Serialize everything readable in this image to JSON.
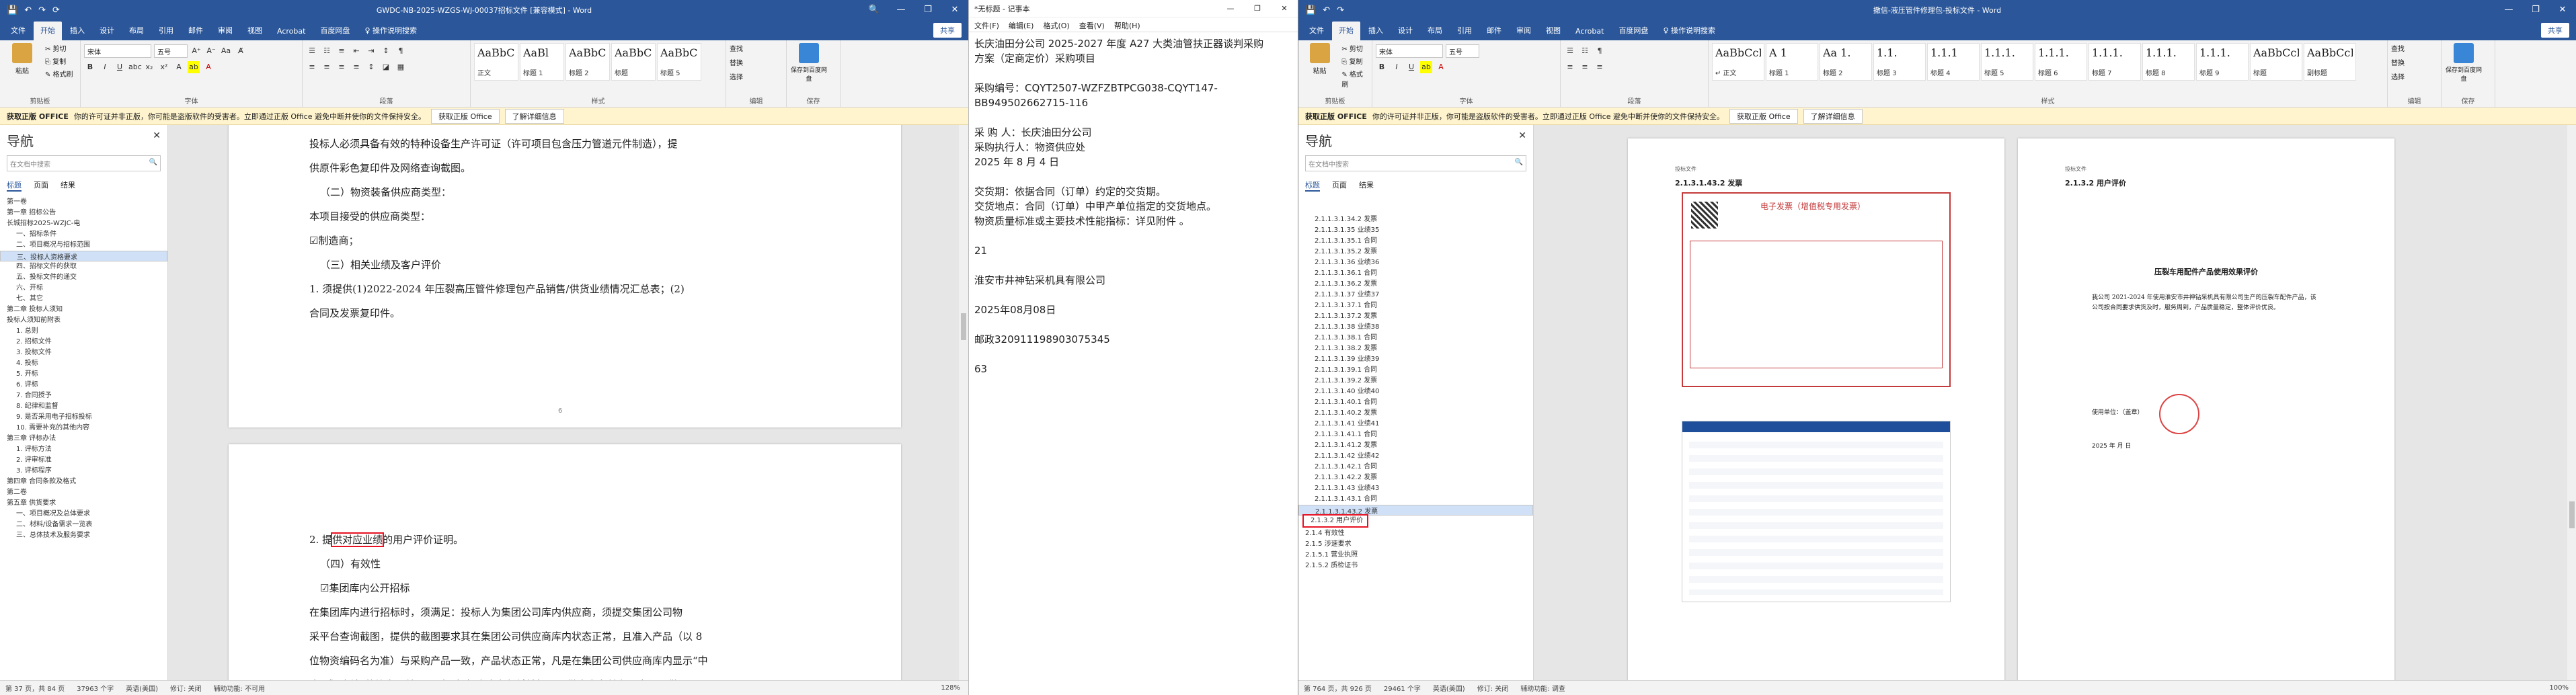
{
  "win1": {
    "title": "GWDC-NB-2025-WZGS-WJ-00037招标文件 [兼容模式] - Word",
    "qa": [
      "💾",
      "↶",
      "↷",
      "⟳"
    ],
    "controls": [
      "🔍",
      "—",
      "❐",
      "✕"
    ],
    "tabs": [
      "文件",
      "开始",
      "插入",
      "设计",
      "布局",
      "引用",
      "邮件",
      "审阅",
      "视图",
      "Acrobat",
      "百度网盘",
      "♀ 操作说明搜索"
    ],
    "share": "共享",
    "ribbon": {
      "clipboard": {
        "paste": "粘贴",
        "cut": "✂ 剪切",
        "copy": "⎘ 复制",
        "painter": "✎ 格式刷",
        "label": "剪贴板"
      },
      "font": {
        "name": "宋体",
        "size": "五号",
        "label": "字体"
      },
      "para": {
        "label": "段落"
      },
      "styles": [
        {
          "sample": "AaBbCcI",
          "name": "正文"
        },
        {
          "sample": "AaBl",
          "name": "标题 1"
        },
        {
          "sample": "AaBbC",
          "name": "标题 2"
        },
        {
          "sample": "AaBbC",
          "name": "标题"
        },
        {
          "sample": "AaBbC",
          "name": "标题 5"
        }
      ],
      "styles_label": "样式",
      "edit": {
        "find": "查找",
        "replace": "替换",
        "select": "选择",
        "label": "编辑"
      },
      "save": {
        "label": "保存到百度网盘",
        "group": "保存"
      }
    },
    "infobar": {
      "product": "获取正版 OFFICE",
      "msg": "你的许可证并非正版，你可能是盗版软件的受害者。立即通过正版 Office 避免中断并使你的文件保持安全。",
      "btn1": "获取正版 Office",
      "btn2": "了解详细信息"
    },
    "nav": {
      "title": "导航",
      "search": "在文档中搜索",
      "tabs": [
        "标题",
        "页面",
        "结果"
      ],
      "items": [
        "第一卷",
        "第一章 招标公告",
        "长城招标2025-WZJC-电",
        "一、招标条件",
        "二、项目概况与招标范围",
        "三、投标人资格要求",
        "四、招标文件的获取",
        "五、投标文件的递交",
        "六、开标",
        "七、其它",
        "第二章 投标人须知",
        "投标人须知前附表",
        "1. 总则",
        "2. 招标文件",
        "3. 投标文件",
        "4. 投标",
        "5. 开标",
        "6. 评标",
        "7. 合同授予",
        "8. 纪律和监督",
        "9. 是否采用电子招标投标",
        "10. 需要补充的其他内容",
        "第三章 评标办法",
        "1. 评标方法",
        "2. 评审标准",
        "3. 评标程序",
        "第四章 合同条款及格式",
        "第二卷",
        "第五章 供货要求",
        "一、项目概况及总体要求",
        "二、材料/设备需求一览表",
        "三、总体技术及服务要求"
      ],
      "selected": 5
    },
    "page1": [
      "投标人必须具备有效的特种设备生产许可证（许可项目包含压力管道元件制造），提",
      "供原件彩色复印件及网络查询截图。",
      "（二）物资装备供应商类型：",
      "本项目接受的供应商类型：",
      "☑制造商；",
      "（三）相关业绩及客户评价",
      "1. 须提供(1)2022-2024 年压裂高压管件修理包产品销售/供货业绩情况汇总表；(2)",
      "合同及发票复印件。"
    ],
    "page_num": "6",
    "page2": [
      "2. 提供对应业绩的用户评价证明。",
      "（四）有效性",
      "☑集团库内公开招标",
      "在集团库内进行招标时，须满足：投标人为集团公司库内供应商，须提交集团公司物",
      "采平台查询截图，提供的截图要求其在集团公司供应商库内状态正常，且准入产品（以 8",
      "位物资编码名为准）与采购产品一致，产品状态正常，凡是在集团公司供应商库内显示“中",
      "止”或“冻结”的均为无效。同时，投标人未在长城钻探公司供应商名单和不良记录供"
    ],
    "highlight": "供对应业绩",
    "status": [
      "第 37 页，共 84 页",
      "37963 个字",
      "英语(美国)",
      "修订: 关闭",
      "辅助功能: 不可用",
      "128%"
    ]
  },
  "notepad": {
    "title": "*无标题 - 记事本",
    "menu": [
      "文件(F)",
      "编辑(E)",
      "格式(O)",
      "查看(V)",
      "帮助(H)"
    ],
    "lines": [
      "长庆油田分公司 2025-2027 年度 A27 大类油管扶正器谈判采购",
      "方案（定商定价）采购项目",
      "",
      "采购编号：CQYT2507-WZFZBTPCG038-CQYT147-",
      "BB949502662715-116",
      "",
      "采 购 人：长庆油田分公司",
      "采购执行人：物资供应处",
      "2025 年 8 月 4 日",
      "",
      "交货期：依据合同（订单）约定的交货期。",
      "交货地点：合同（订单）中甲产单位指定的交货地点。",
      "物资质量标准或主要技术性能指标：详见附件 。",
      "",
      "21",
      "",
      "淮安市井神钻采机具有限公司",
      "",
      "2025年08月08日",
      "",
      "邮政320911198903075345",
      "",
      "63"
    ]
  },
  "win2": {
    "title": "撒信-液压管件修理包-投标文件 - Word",
    "tabs": [
      "文件",
      "开始",
      "插入",
      "设计",
      "布局",
      "引用",
      "邮件",
      "审阅",
      "视图",
      "Acrobat",
      "百度网盘",
      "♀ 操作说明搜索"
    ],
    "styles": [
      {
        "sample": "AaBbCcD",
        "name": "↵ 正文"
      },
      {
        "sample": "A 1",
        "name": "标题 1"
      },
      {
        "sample": "Aa 1.",
        "name": "标题 2"
      },
      {
        "sample": "1.1.",
        "name": "标题 3"
      },
      {
        "sample": "1.1.1",
        "name": "标题 4"
      },
      {
        "sample": "1.1.1.",
        "name": "标题 5"
      },
      {
        "sample": "1.1.1.",
        "name": "标题 6"
      },
      {
        "sample": "1.1.1.",
        "name": "标题 7"
      },
      {
        "sample": "1.1.1.",
        "name": "标题 8"
      },
      {
        "sample": "1.1.1.",
        "name": "标题 9"
      },
      {
        "sample": "AaBbCcD",
        "name": "标题"
      },
      {
        "sample": "AaBbCcD",
        "name": "副标题"
      }
    ],
    "nav": {
      "title": "导航",
      "search": "在文档中搜索",
      "tabs": [
        "标题",
        "页面",
        "结果"
      ],
      "items": [
        "2.1.1.3.1.34.2 发票",
        "2.1.1.3.1.35 业绩35",
        "2.1.1.3.1.35.1 合同",
        "2.1.1.3.1.35.2 发票",
        "2.1.1.3.1.36 业绩36",
        "2.1.1.3.1.36.1 合同",
        "2.1.1.3.1.36.2 发票",
        "2.1.1.3.1.37 业绩37",
        "2.1.1.3.1.37.1 合同",
        "2.1.1.3.1.37.2 发票",
        "2.1.1.3.1.38 业绩38",
        "2.1.1.3.1.38.1 合同",
        "2.1.1.3.1.38.2 发票",
        "2.1.1.3.1.39 业绩39",
        "2.1.1.3.1.39.1 合同",
        "2.1.1.3.1.39.2 发票",
        "2.1.1.3.1.40 业绩40",
        "2.1.1.3.1.40.1 合同",
        "2.1.1.3.1.40.2 发票",
        "2.1.1.3.1.41 业绩41",
        "2.1.1.3.1.41.1 合同",
        "2.1.1.3.1.41.2 发票",
        "2.1.1.3.1.42 业绩42",
        "2.1.1.3.1.42.1 合同",
        "2.1.1.3.1.42.2 发票",
        "2.1.1.3.1.43 业绩43",
        "2.1.1.3.1.43.1 合同",
        "2.1.1.3.1.43.2 发票",
        "2.1.3.2 用户评价",
        "2.1.4 有效性",
        "2.1.5 涉速要求",
        "2.1.5.1 营业执照",
        "2.1.5.2 质检证书"
      ],
      "selected": 27,
      "boxed": 28
    },
    "page_left": {
      "hdr": "投标文件",
      "h": "2.1.3.1.43.2 发票",
      "inv_title": "电子发票（增值税专用发票）"
    },
    "page_right": {
      "hdr": "投标文件",
      "h": "2.1.3.2 用户评价",
      "t": "压裂车用配件产品使用效果评价",
      "body": "我公司 2021-2024 年使用淮安市井神钻采机具有限公司生产的压裂车配件产品，该公司按合同要求供货及时，服务周到，产品质量稳定，整体评价优良。",
      "sign": "使用单位：（盖章）",
      "date": "2025 年 月 日"
    },
    "status": [
      "第 764 页，共 926 页",
      "29461 个字",
      "英语(美国)",
      "修订: 关闭",
      "辅助功能: 调查",
      "100%"
    ]
  }
}
